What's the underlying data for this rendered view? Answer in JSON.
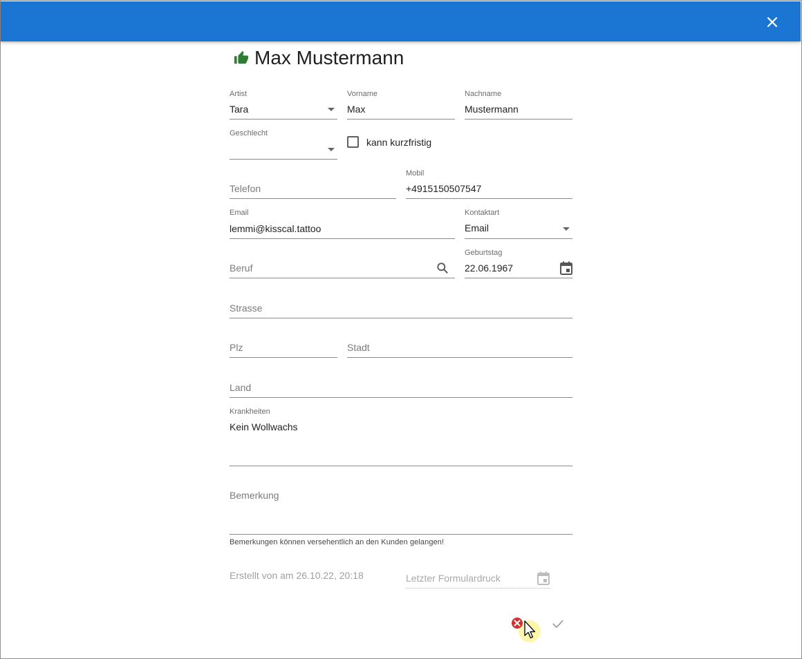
{
  "title": "Max Mustermann",
  "status_icon": "thumbs-up-icon",
  "colors": {
    "appbar": "#1a76d2",
    "thumb": "#2e7d32",
    "error": "#d32f2f"
  },
  "fields": {
    "artist": {
      "label": "Artist",
      "value": "Tara"
    },
    "vorname": {
      "label": "Vorname",
      "value": "Max"
    },
    "nachname": {
      "label": "Nachname",
      "value": "Mustermann"
    },
    "geschlecht": {
      "label": "Geschlecht",
      "value": ""
    },
    "kurzfristig": {
      "label": "kann kurzfristig",
      "checked": false
    },
    "telefon": {
      "placeholder": "Telefon",
      "value": ""
    },
    "mobil": {
      "label": "Mobil",
      "value": "+4915150507547"
    },
    "email": {
      "label": "Email",
      "value": "lemmi@kisscal.tattoo"
    },
    "kontaktart": {
      "label": "Kontaktart",
      "value": "Email"
    },
    "beruf": {
      "placeholder": "Beruf",
      "value": ""
    },
    "geburtstag": {
      "label": "Geburtstag",
      "value": "22.06.1967"
    },
    "strasse": {
      "placeholder": "Strasse",
      "value": ""
    },
    "plz": {
      "placeholder": "Plz",
      "value": ""
    },
    "stadt": {
      "placeholder": "Stadt",
      "value": ""
    },
    "land": {
      "placeholder": "Land",
      "value": ""
    },
    "krankheiten": {
      "label": "Krankheiten",
      "value": "Kein Wollwachs"
    },
    "bemerkung": {
      "placeholder": "Bemerkung",
      "value": "",
      "hint": "Bemerkungen können versehentlich an den Kunden gelangen!"
    },
    "formulardruck": {
      "placeholder": "Letzter Formulardruck",
      "value": ""
    }
  },
  "created_text": "Erstellt von am 26.10.22, 20:18",
  "actions": {
    "cancel_icon": "cancel-icon",
    "confirm_icon": "check-icon"
  }
}
